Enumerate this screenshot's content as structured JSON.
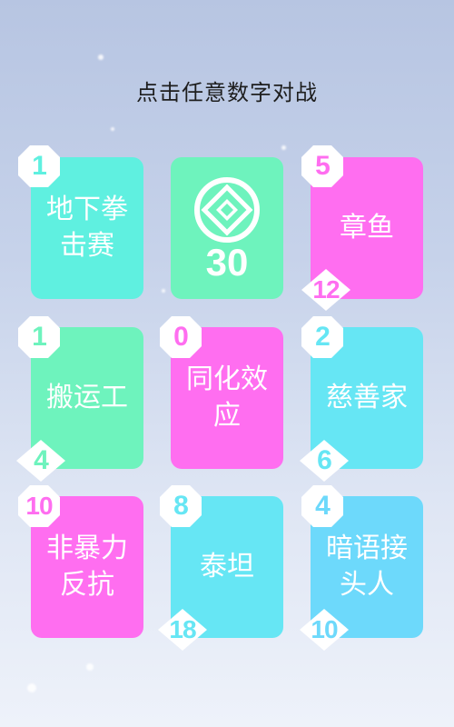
{
  "header": {
    "title": "点击任意数字对战"
  },
  "colors": {
    "teal": "#5ff0e0",
    "green": "#6ef3bd",
    "magenta": "#ff6ef0",
    "cyan": "#66e6f4",
    "sky": "#6dd9fb"
  },
  "cards": [
    {
      "label": "地下拳击赛",
      "top_badge": "1",
      "bottom_badge": "",
      "color": "#5ff0e0"
    },
    {
      "label": "",
      "top_badge": "",
      "bottom_badge": "",
      "color": "#6ef3bd",
      "cost": "30",
      "icon": "coin-icon"
    },
    {
      "label": "章鱼",
      "top_badge": "5",
      "bottom_badge": "12",
      "color": "#ff6ef0"
    },
    {
      "label": "搬运工",
      "top_badge": "1",
      "bottom_badge": "4",
      "color": "#6ef3bd"
    },
    {
      "label": "同化效应",
      "top_badge": "0",
      "bottom_badge": "",
      "color": "#ff6ef0"
    },
    {
      "label": "慈善家",
      "top_badge": "2",
      "bottom_badge": "6",
      "color": "#66e6f4"
    },
    {
      "label": "非暴力反抗",
      "top_badge": "10",
      "bottom_badge": "",
      "color": "#ff6ef0"
    },
    {
      "label": "泰坦",
      "top_badge": "8",
      "bottom_badge": "18",
      "color": "#66e6f4"
    },
    {
      "label": "暗语接头人",
      "top_badge": "4",
      "bottom_badge": "10",
      "color": "#6dd9fb"
    }
  ]
}
